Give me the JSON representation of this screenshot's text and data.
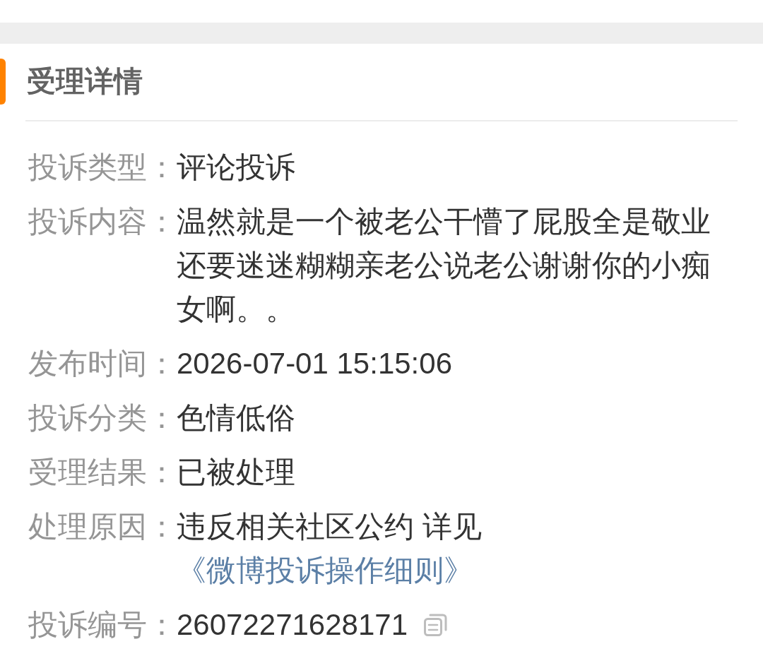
{
  "section": {
    "title": "受理详情"
  },
  "fields": [
    {
      "kind": "text",
      "label": "投诉类型：",
      "value": "评论投诉"
    },
    {
      "kind": "text",
      "label": "投诉内容：",
      "value": "温然就是一个被老公干懵了屁股全是敬业还要迷迷糊糊亲老公说老公谢谢你的小痴女啊。。"
    },
    {
      "kind": "text",
      "label": "发布时间：",
      "value": "2026-07-01 15:15:06"
    },
    {
      "kind": "text",
      "label": "投诉分类：",
      "value": "色情低俗"
    },
    {
      "kind": "text",
      "label": "受理结果：",
      "value": "已被处理"
    },
    {
      "kind": "link",
      "label": "处理原因：",
      "value": "违反相关社区公约 详见",
      "link": "《微博投诉操作细则》"
    },
    {
      "kind": "copy",
      "label": "投诉编号：",
      "value": "26072271628171"
    }
  ]
}
